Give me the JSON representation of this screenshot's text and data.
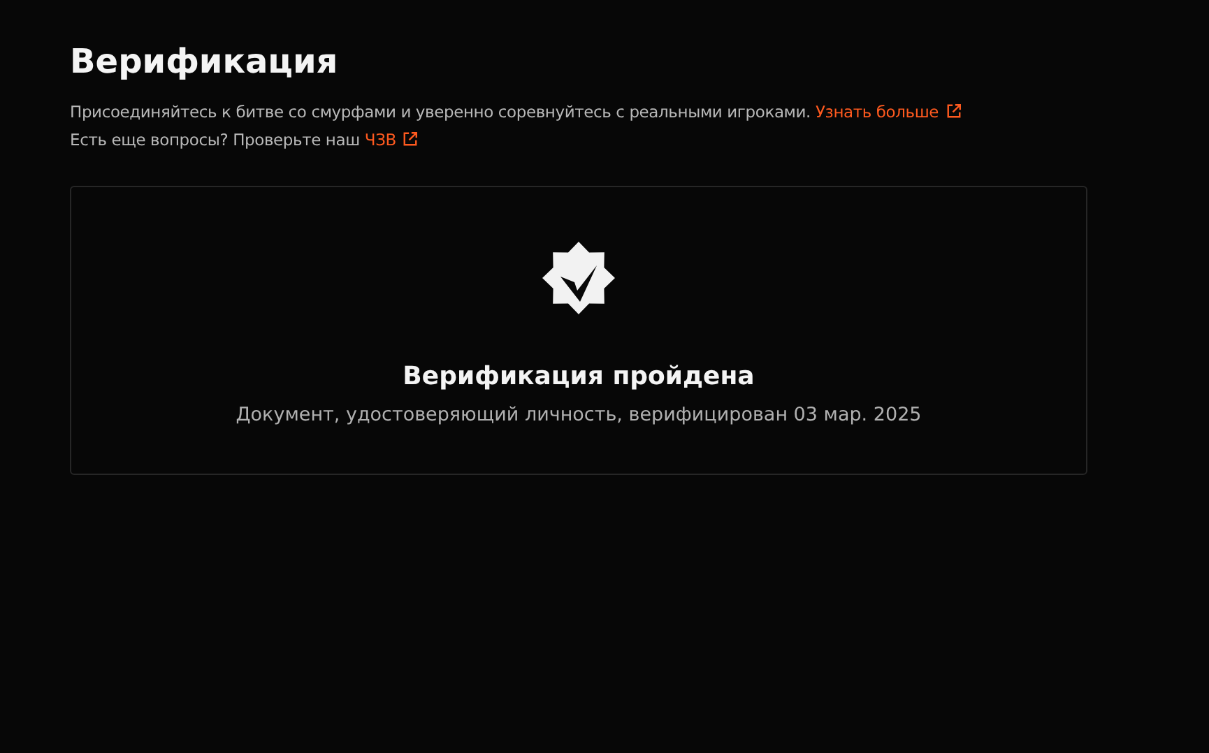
{
  "page_title": "Верификация",
  "info_lines": [
    {
      "text": "Присоединяйтесь к битве со смурфами и уверенно соревнуйтесь с реальными игроками.",
      "link": "Узнать больше"
    },
    {
      "text": "Есть еще вопросы? Проверьте наш",
      "link": "ЧЗВ"
    }
  ],
  "status_card": {
    "verified": true,
    "title": "Верификация пройдена",
    "description": "Документ, удостоверяющий личность, верифицирован 03 мар. 2025"
  }
}
